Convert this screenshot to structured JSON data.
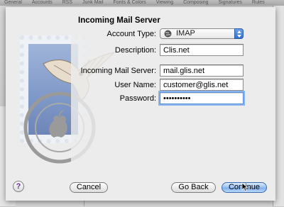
{
  "background_toolbar": {
    "items": [
      "General",
      "Accounts",
      "RSS",
      "Junk Mail",
      "Fonts & Colors",
      "Viewing",
      "Composing",
      "Signatures",
      "Rules"
    ]
  },
  "sheet": {
    "section_title": "Incoming Mail Server",
    "account_type": {
      "label": "Account Type:",
      "value": "IMAP",
      "icon": "globe-icon"
    },
    "description": {
      "label": "Description:",
      "value": "Clis.net"
    },
    "incoming_server": {
      "label": "Incoming Mail Server:",
      "value": "mail.glis.net"
    },
    "user_name": {
      "label": "User Name:",
      "value": "customer@glis.net"
    },
    "password": {
      "label": "Password:",
      "value": "••••••••••"
    }
  },
  "buttons": {
    "help_label": "?",
    "cancel_label": "Cancel",
    "go_back_label": "Go Back",
    "continue_label": "Continue"
  },
  "colors": {
    "accent": "#7fb0ee",
    "focus_ring": "#8ab4ee",
    "sheet_bg": "#ececec"
  }
}
